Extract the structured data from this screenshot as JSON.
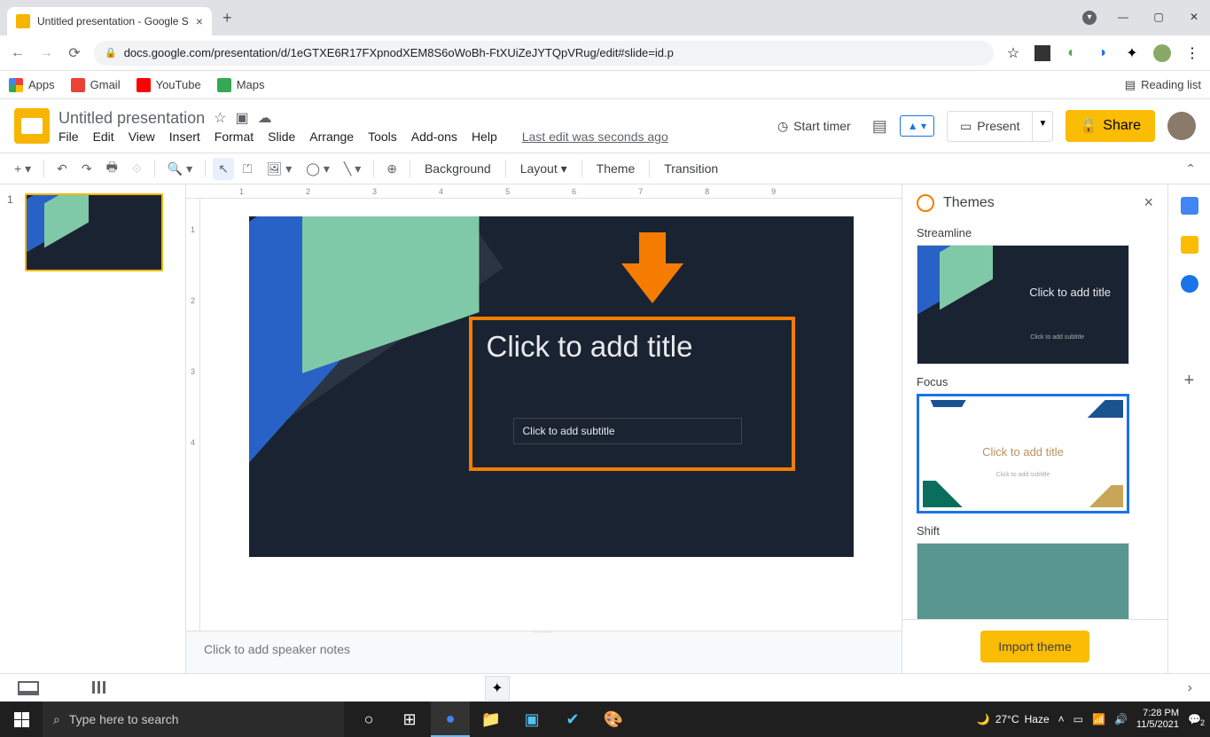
{
  "browser": {
    "tab_title": "Untitled presentation - Google S",
    "url": "docs.google.com/presentation/d/1eGTXE6R17FXpnodXEM8S6oWoBh-FtXUiZeJYTQpVRug/edit#slide=id.p",
    "bookmarks": {
      "apps": "Apps",
      "gmail": "Gmail",
      "youtube": "YouTube",
      "maps": "Maps",
      "reading_list": "Reading list"
    }
  },
  "doc": {
    "title": "Untitled presentation",
    "last_edit": "Last edit was seconds ago"
  },
  "menus": {
    "file": "File",
    "edit": "Edit",
    "view": "View",
    "insert": "Insert",
    "format": "Format",
    "slide": "Slide",
    "arrange": "Arrange",
    "tools": "Tools",
    "addons": "Add-ons",
    "help": "Help"
  },
  "header_buttons": {
    "start_timer": "Start timer",
    "present": "Present",
    "share": "Share"
  },
  "toolbar": {
    "background": "Background",
    "layout": "Layout",
    "theme": "Theme",
    "transition": "Transition"
  },
  "slide": {
    "title_placeholder": "Click to add title",
    "subtitle_placeholder": "Click to add subtitle",
    "notes_placeholder": "Click to add speaker notes"
  },
  "filmstrip": {
    "slide_number": "1"
  },
  "themes": {
    "panel_title": "Themes",
    "streamline": "Streamline",
    "focus": "Focus",
    "shift": "Shift",
    "thumb_title": "Click to add title",
    "thumb_sub": "Click to add subtitle",
    "import": "Import theme"
  },
  "ruler_h": [
    "1",
    "2",
    "3",
    "4",
    "5",
    "6",
    "7",
    "8",
    "9"
  ],
  "ruler_v": [
    "1",
    "2",
    "3",
    "4"
  ],
  "taskbar": {
    "search_placeholder": "Type here to search",
    "weather_temp": "27°C",
    "weather_cond": "Haze",
    "time": "7:28 PM",
    "date": "11/5/2021",
    "notif_count": "2"
  }
}
